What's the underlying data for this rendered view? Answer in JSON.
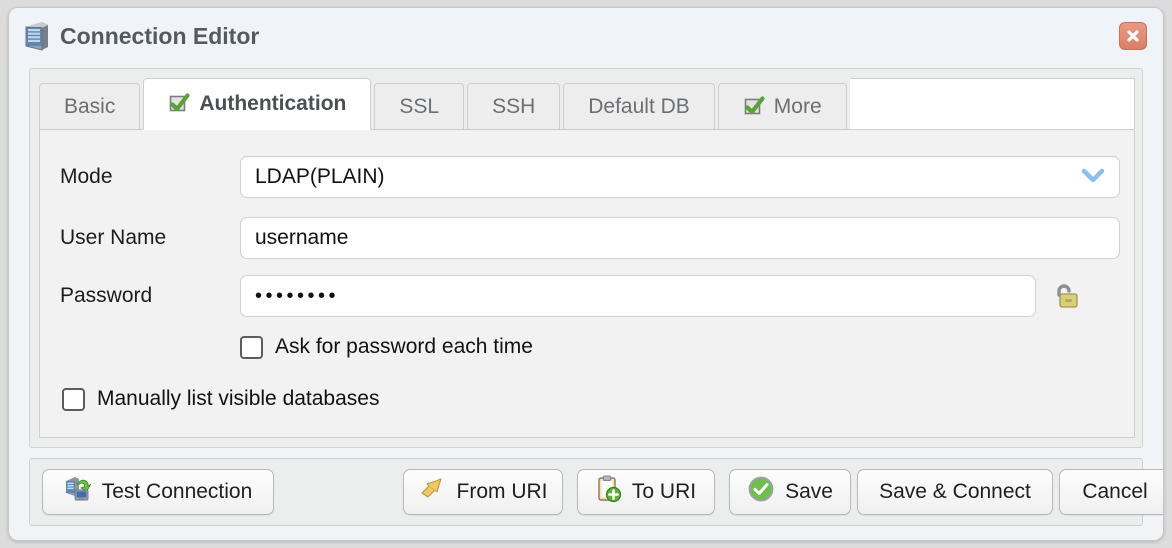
{
  "window": {
    "title": "Connection Editor",
    "title_icon": "server-icon",
    "close_icon": "close-icon",
    "close_color": "#d97f66"
  },
  "tabs": [
    {
      "label": "Basic",
      "active": false,
      "icon": null
    },
    {
      "label": "Authentication",
      "active": true,
      "icon": "green-check-icon"
    },
    {
      "label": "SSL",
      "active": false,
      "icon": null
    },
    {
      "label": "SSH",
      "active": false,
      "icon": null
    },
    {
      "label": "Default DB",
      "active": false,
      "icon": null
    },
    {
      "label": "More",
      "active": false,
      "icon": "green-check-icon"
    }
  ],
  "form": {
    "mode": {
      "label": "Mode",
      "value": "LDAP(PLAIN)",
      "dropdown_icon": "chevron-down-icon",
      "dropdown_color": "#8fbdec"
    },
    "user_name": {
      "label": "User Name",
      "value": "username",
      "placeholder": ""
    },
    "password": {
      "label": "Password",
      "value": "••••••••",
      "placeholder": "",
      "lock_icon": "unlocked-padlock-icon"
    },
    "ask_each_time": {
      "label": "Ask for password each time",
      "checked": false
    },
    "manual_databases": {
      "label": "Manually list visible databases",
      "checked": false
    }
  },
  "footer": {
    "test_connection": {
      "label": "Test Connection",
      "icon": "server-refresh-icon"
    },
    "from_uri": {
      "label": "From URI",
      "icon": "import-arrow-icon"
    },
    "to_uri": {
      "label": "To URI",
      "icon": "clipboard-plus-icon"
    },
    "save": {
      "label": "Save",
      "icon": "green-check-circle-icon"
    },
    "save_connect": {
      "label": "Save & Connect",
      "icon": null
    },
    "cancel": {
      "label": "Cancel",
      "icon": null
    }
  }
}
